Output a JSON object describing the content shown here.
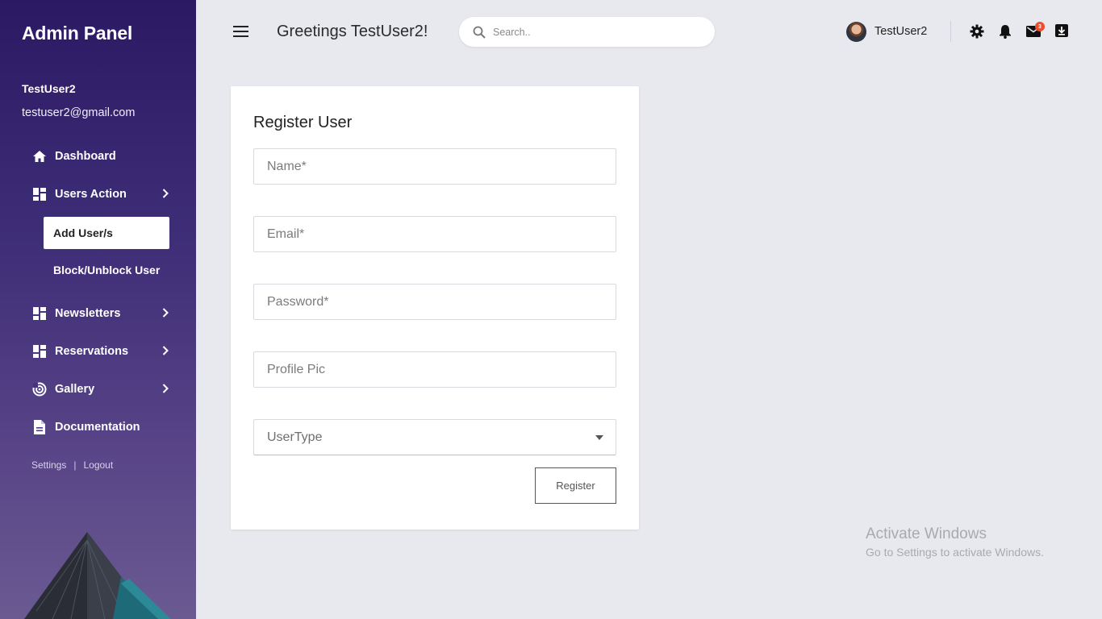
{
  "sidebar": {
    "brand": "Admin Panel",
    "user_name": "TestUser2",
    "user_email": "testuser2@gmail.com",
    "nav": {
      "dashboard": "Dashboard",
      "users_action": "Users Action",
      "add_users": "Add User/s",
      "block_unblock": "Block/Unblock User",
      "newsletters": "Newsletters",
      "reservations": "Reservations",
      "gallery": "Gallery",
      "documentation": "Documentation"
    },
    "settings_link": "Settings",
    "separator": "|",
    "logout_link": "Logout"
  },
  "header": {
    "greeting": "Greetings TestUser2!",
    "search_placeholder": "Search..",
    "user_name": "TestUser2",
    "mail_badge": "3",
    "icons": [
      "menu-icon",
      "search-icon",
      "avatar",
      "gear-icon",
      "bell-icon",
      "mail-icon",
      "download-icon"
    ]
  },
  "form": {
    "title": "Register User",
    "name_placeholder": "Name*",
    "email_placeholder": "Email*",
    "password_placeholder": "Password*",
    "profile_pic_placeholder": "Profile Pic",
    "usertype_value": "UserType",
    "register_label": "Register"
  },
  "watermark": {
    "title": "Activate Windows",
    "subtitle": "Go to Settings to activate Windows."
  },
  "colors": {
    "sidebar_top": "#2b1a63",
    "sidebar_bottom": "#6a5a92",
    "page_bg": "#e8e9ef",
    "badge": "#f04b2b"
  }
}
